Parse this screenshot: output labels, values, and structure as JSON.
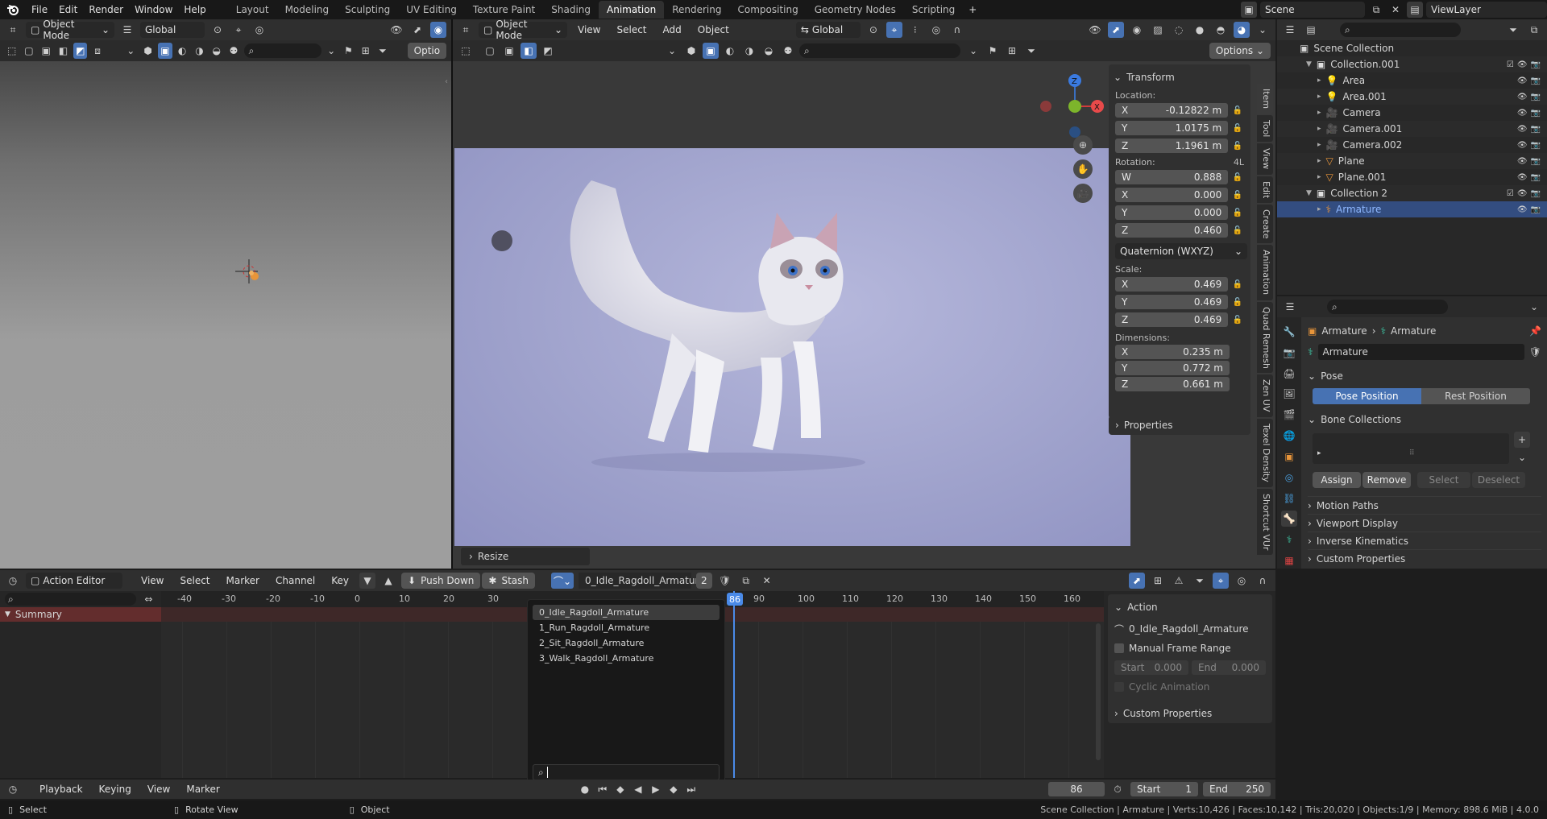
{
  "topbar": {
    "menus": [
      "File",
      "Edit",
      "Render",
      "Window",
      "Help"
    ],
    "workspaces": [
      "Layout",
      "Modeling",
      "Sculpting",
      "UV Editing",
      "Texture Paint",
      "Shading",
      "Animation",
      "Rendering",
      "Compositing",
      "Geometry Nodes",
      "Scripting"
    ],
    "active_workspace": "Animation",
    "add_tab": "+",
    "scene": "Scene",
    "view_layer": "ViewLayer"
  },
  "left_viewport": {
    "mode": "Object Mode",
    "orientation": "Global",
    "options": "Optio"
  },
  "main_viewport": {
    "mode": "Object Mode",
    "menus": [
      "View",
      "Select",
      "Add",
      "Object"
    ],
    "orientation": "Global",
    "options": "Options",
    "resize": "Resize",
    "gizmo": {
      "z": "Z",
      "x": "X"
    }
  },
  "npanel": {
    "title": "Transform",
    "location_label": "Location:",
    "location": [
      {
        "axis": "X",
        "value": "-0.12822 m"
      },
      {
        "axis": "Y",
        "value": "1.0175 m"
      },
      {
        "axis": "Z",
        "value": "1.1961 m"
      }
    ],
    "rotation_label": "Rotation:",
    "rotation_mode_short": "4L",
    "rotation": [
      {
        "axis": "W",
        "value": "0.888"
      },
      {
        "axis": "X",
        "value": "0.000"
      },
      {
        "axis": "Y",
        "value": "0.000"
      },
      {
        "axis": "Z",
        "value": "0.460"
      }
    ],
    "rotation_mode": "Quaternion (WXYZ)",
    "scale_label": "Scale:",
    "scale": [
      {
        "axis": "X",
        "value": "0.469"
      },
      {
        "axis": "Y",
        "value": "0.469"
      },
      {
        "axis": "Z",
        "value": "0.469"
      }
    ],
    "dimensions_label": "Dimensions:",
    "dimensions": [
      {
        "axis": "X",
        "value": "0.235 m"
      },
      {
        "axis": "Y",
        "value": "0.772 m"
      },
      {
        "axis": "Z",
        "value": "0.661 m"
      }
    ],
    "properties": "Properties",
    "tabs": [
      "Item",
      "Tool",
      "View",
      "Edit",
      "Create",
      "Animation",
      "Quad Remesh",
      "Zen UV",
      "Texel Density",
      "Shortcut VUr"
    ]
  },
  "outliner": {
    "scene_collection": "Scene Collection",
    "items": [
      {
        "name": "Collection.001",
        "type": "collection",
        "depth": 1
      },
      {
        "name": "Area",
        "type": "light",
        "depth": 2
      },
      {
        "name": "Area.001",
        "type": "light",
        "depth": 2
      },
      {
        "name": "Camera",
        "type": "camera",
        "depth": 2
      },
      {
        "name": "Camera.001",
        "type": "camera",
        "depth": 2
      },
      {
        "name": "Camera.002",
        "type": "camera",
        "depth": 2
      },
      {
        "name": "Plane",
        "type": "mesh",
        "depth": 2
      },
      {
        "name": "Plane.001",
        "type": "mesh",
        "depth": 2
      },
      {
        "name": "Collection 2",
        "type": "collection",
        "depth": 1
      },
      {
        "name": "Armature",
        "type": "armature",
        "depth": 2,
        "selected": true
      }
    ]
  },
  "properties": {
    "breadcrumb": [
      "Armature",
      "Armature"
    ],
    "name": "Armature",
    "pose_title": "Pose",
    "pose_position": "Pose Position",
    "rest_position": "Rest Position",
    "bone_collections": "Bone Collections",
    "assign": "Assign",
    "remove": "Remove",
    "select": "Select",
    "deselect": "Deselect",
    "sections": [
      "Motion Paths",
      "Viewport Display",
      "Inverse Kinematics",
      "Custom Properties"
    ]
  },
  "action_editor": {
    "editor": "Action Editor",
    "menus": [
      "View",
      "Select",
      "Marker",
      "Channel",
      "Key"
    ],
    "push_down": "Push Down",
    "stash": "Stash",
    "action_name": "0_Idle_Ragdoll_Armature",
    "users": "2",
    "summary": "Summary",
    "ruler": [
      "-40",
      "-30",
      "-20",
      "-10",
      "0",
      "10",
      "20",
      "30",
      "",
      "",
      "",
      "",
      "",
      "90",
      "100",
      "110",
      "120",
      "130",
      "140",
      "150",
      "160"
    ],
    "current_frame_label": "86",
    "dropdown_items": [
      "0_Idle_Ragdoll_Armature",
      "1_Run_Ragdoll_Armature",
      "2_Sit_Ragdoll_Armature",
      "3_Walk_Ragdoll_Armature"
    ],
    "side": {
      "title": "Action",
      "action": "0_Idle_Ragdoll_Armature",
      "manual_range": "Manual Frame Range",
      "start_label": "Start",
      "start": "0.000",
      "end_label": "End",
      "end": "0.000",
      "cyclic": "Cyclic Animation",
      "custom_props": "Custom Properties"
    }
  },
  "timeline": {
    "menus": [
      "Playback",
      "Keying",
      "View",
      "Marker"
    ],
    "frame": "86",
    "start_label": "Start",
    "start": "1",
    "end_label": "End",
    "end": "250"
  },
  "status": {
    "select": "Select",
    "rotate": "Rotate View",
    "object": "Object",
    "stats": "Scene Collection | Armature | Verts:10,426 | Faces:10,142 | Tris:20,020 | Objects:1/9 | Memory: 898.6 MiB | 4.0.0"
  },
  "colors": {
    "accent": "#4772b3",
    "bg": "#1d1d1d",
    "panel": "#303030",
    "viewport": "#3d3d3d",
    "render_bg": "#a3a6cf"
  }
}
